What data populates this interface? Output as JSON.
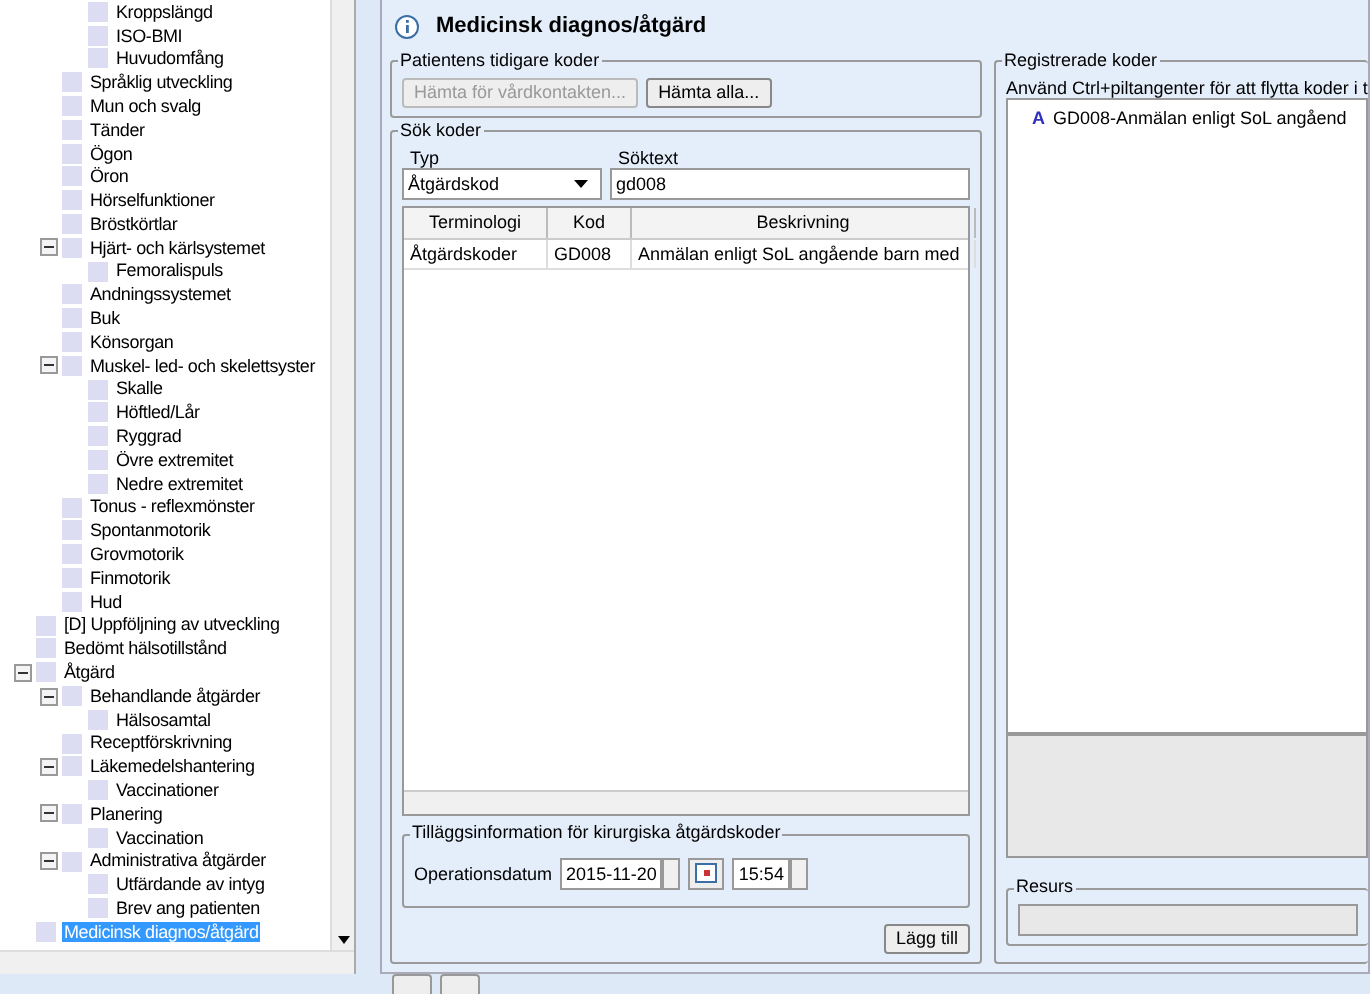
{
  "tree": {
    "items": [
      {
        "children": [
          {
            "children": [
              {
                "label": "Kroppslängd",
                "selected": false
              },
              {
                "label": "ISO-BMI",
                "selected": false
              },
              {
                "label": "Huvudomfång",
                "selected": false
              }
            ]
          },
          {
            "label": "Språklig utveckling",
            "selected": false
          },
          {
            "label": "Mun och svalg",
            "selected": false
          },
          {
            "label": "Tänder",
            "selected": false
          },
          {
            "label": "Ögon",
            "selected": false
          },
          {
            "label": "Öron",
            "selected": false
          },
          {
            "label": "Hörselfunktioner",
            "selected": false
          },
          {
            "label": "Bröstkörtlar",
            "selected": false
          },
          {
            "label": "Hjärt- och kärlsystemet",
            "selected": false,
            "expanded": true,
            "children": [
              {
                "label": "Femoralispuls",
                "selected": false
              }
            ]
          },
          {
            "label": "Andningssystemet",
            "selected": false
          },
          {
            "label": "Buk",
            "selected": false
          },
          {
            "label": "Könsorgan",
            "selected": false
          },
          {
            "label": "Muskel- led- och skelettsyster",
            "selected": false,
            "expanded": true,
            "children": [
              {
                "label": "Skalle",
                "selected": false
              },
              {
                "label": "Höftled/Lår",
                "selected": false
              },
              {
                "label": "Ryggrad",
                "selected": false
              },
              {
                "label": "Övre extremitet",
                "selected": false
              },
              {
                "label": "Nedre extremitet",
                "selected": false
              }
            ]
          },
          {
            "label": "Tonus - reflexmönster",
            "selected": false
          },
          {
            "label": "Spontanmotorik",
            "selected": false
          },
          {
            "label": "Grovmotorik",
            "selected": false
          },
          {
            "label": "Finmotorik",
            "selected": false
          },
          {
            "label": "Hud",
            "selected": false
          }
        ]
      },
      {
        "label": "[D] Uppföljning av utveckling",
        "selected": false
      },
      {
        "label": "Bedömt hälsotillstånd",
        "selected": false
      },
      {
        "label": "Åtgärd",
        "selected": false,
        "expanded": true,
        "children": [
          {
            "label": "Behandlande åtgärder",
            "selected": false,
            "expanded": true,
            "children": [
              {
                "label": "Hälsosamtal",
                "selected": false
              }
            ]
          },
          {
            "label": "Receptförskrivning",
            "selected": false
          },
          {
            "label": "Läkemedelshantering",
            "selected": false,
            "expanded": true,
            "children": [
              {
                "label": "Vaccinationer",
                "selected": false
              }
            ]
          },
          {
            "label": "Planering",
            "selected": false,
            "expanded": true,
            "children": [
              {
                "label": "Vaccination",
                "selected": false
              }
            ]
          },
          {
            "label": "Administrativa åtgärder",
            "selected": false,
            "expanded": true,
            "children": [
              {
                "label": "Utfärdande av intyg",
                "selected": false
              },
              {
                "label": "Brev ang patienten",
                "selected": false
              }
            ]
          }
        ]
      },
      {
        "label": "Medicinsk diagnos/åtgärd",
        "selected": true
      }
    ]
  },
  "panel": {
    "title": "Medicinsk diagnos/åtgärd"
  },
  "previous_codes": {
    "legend": "Patientens tidigare koder",
    "buttons": [
      {
        "label": "Hämta för vårdkontakten...",
        "disabled": true
      },
      {
        "label": "Hämta alla...",
        "disabled": false
      }
    ]
  },
  "search": {
    "legend": "Sök koder",
    "type_label": "Typ",
    "type_value": "Åtgärdskod",
    "text_label": "Söktext",
    "text_value": "gd008",
    "table": {
      "columns": [
        "Terminologi",
        "Kod",
        "Beskrivning"
      ],
      "rows": [
        {
          "cells": [
            "Åtgärdskoder",
            "GD008",
            "Anmälan enligt SoL angående barn med"
          ],
          "selected": false
        }
      ]
    }
  },
  "surgical": {
    "legend": "Tilläggsinformation för kirurgiska åtgärdskoder",
    "date_label": "Operationsdatum",
    "date": "2015-11-20",
    "time": "15:54"
  },
  "add_button": "Lägg till",
  "registered": {
    "legend": "Registrerade koder",
    "hint": "Använd Ctrl+piltangenter för att flytta koder i t",
    "items": [
      {
        "marker": "A",
        "label": "GD008-Anmälan enligt SoL angåend"
      }
    ]
  },
  "resource": {
    "legend": "Resurs"
  }
}
